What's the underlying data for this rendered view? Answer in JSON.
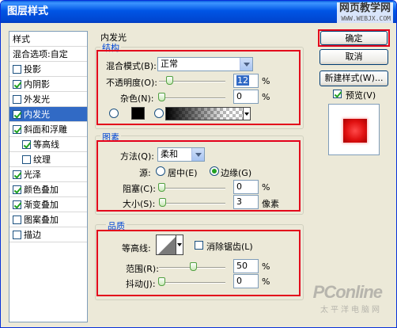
{
  "window": {
    "title": "图层样式"
  },
  "watermark_top": {
    "line1": "网页教学网",
    "line2": "WWW.WEBJX.COM"
  },
  "sidebar": {
    "header": "样式",
    "items": [
      {
        "label": "混合选项:自定",
        "checkbox": false,
        "checked": false,
        "selected": false,
        "sub": false
      },
      {
        "label": "投影",
        "checkbox": true,
        "checked": false,
        "selected": false,
        "sub": false
      },
      {
        "label": "内阴影",
        "checkbox": true,
        "checked": true,
        "selected": false,
        "sub": false
      },
      {
        "label": "外发光",
        "checkbox": true,
        "checked": false,
        "selected": false,
        "sub": false
      },
      {
        "label": "内发光",
        "checkbox": true,
        "checked": true,
        "selected": true,
        "sub": false
      },
      {
        "label": "斜面和浮雕",
        "checkbox": true,
        "checked": true,
        "selected": false,
        "sub": false
      },
      {
        "label": "等高线",
        "checkbox": true,
        "checked": true,
        "selected": false,
        "sub": true
      },
      {
        "label": "纹理",
        "checkbox": true,
        "checked": false,
        "selected": false,
        "sub": true
      },
      {
        "label": "光泽",
        "checkbox": true,
        "checked": true,
        "selected": false,
        "sub": false
      },
      {
        "label": "颜色叠加",
        "checkbox": true,
        "checked": true,
        "selected": false,
        "sub": false
      },
      {
        "label": "渐变叠加",
        "checkbox": true,
        "checked": true,
        "selected": false,
        "sub": false
      },
      {
        "label": "图案叠加",
        "checkbox": true,
        "checked": false,
        "selected": false,
        "sub": false
      },
      {
        "label": "描边",
        "checkbox": true,
        "checked": false,
        "selected": false,
        "sub": false
      }
    ]
  },
  "panel": {
    "title": "内发光"
  },
  "structure": {
    "group_label": "结构",
    "blend_mode_label": "混合模式(B):",
    "blend_mode_value": "正常",
    "opacity_label": "不透明度(O):",
    "opacity_value": "12",
    "opacity_unit": "%",
    "opacity_level": 12,
    "noise_label": "杂色(N):",
    "noise_value": "0",
    "noise_unit": "%",
    "noise_level": 0,
    "color_swatch": "#000000"
  },
  "elements": {
    "group_label": "图素",
    "method_label": "方法(Q):",
    "method_value": "柔和",
    "source_label": "源:",
    "source_center": "居中(E)",
    "source_edge": "边缘(G)",
    "source_selected": "edge",
    "choke_label": "阻塞(C):",
    "choke_value": "0",
    "choke_unit": "%",
    "choke_level": 0,
    "size_label": "大小(S):",
    "size_value": "3",
    "size_unit": "像素",
    "size_level": 3
  },
  "quality": {
    "group_label": "品质",
    "contour_label": "等高线:",
    "antialias_label": "消除锯齿(L)",
    "antialias_checked": false,
    "range_label": "范围(R):",
    "range_value": "50",
    "range_unit": "%",
    "range_level": 50,
    "jitter_label": "抖动(J):",
    "jitter_value": "0",
    "jitter_unit": "%",
    "jitter_level": 0
  },
  "buttons": {
    "ok": "确定",
    "cancel": "取消",
    "new_style": "新建样式(W)...",
    "preview_label": "预览(V)",
    "preview_checked": true
  },
  "colors": {
    "accent_red": "#e3001b",
    "preview_red": "#e01010"
  },
  "watermark_bottom": {
    "line1": "PConline",
    "line2": "太平洋电脑网"
  }
}
